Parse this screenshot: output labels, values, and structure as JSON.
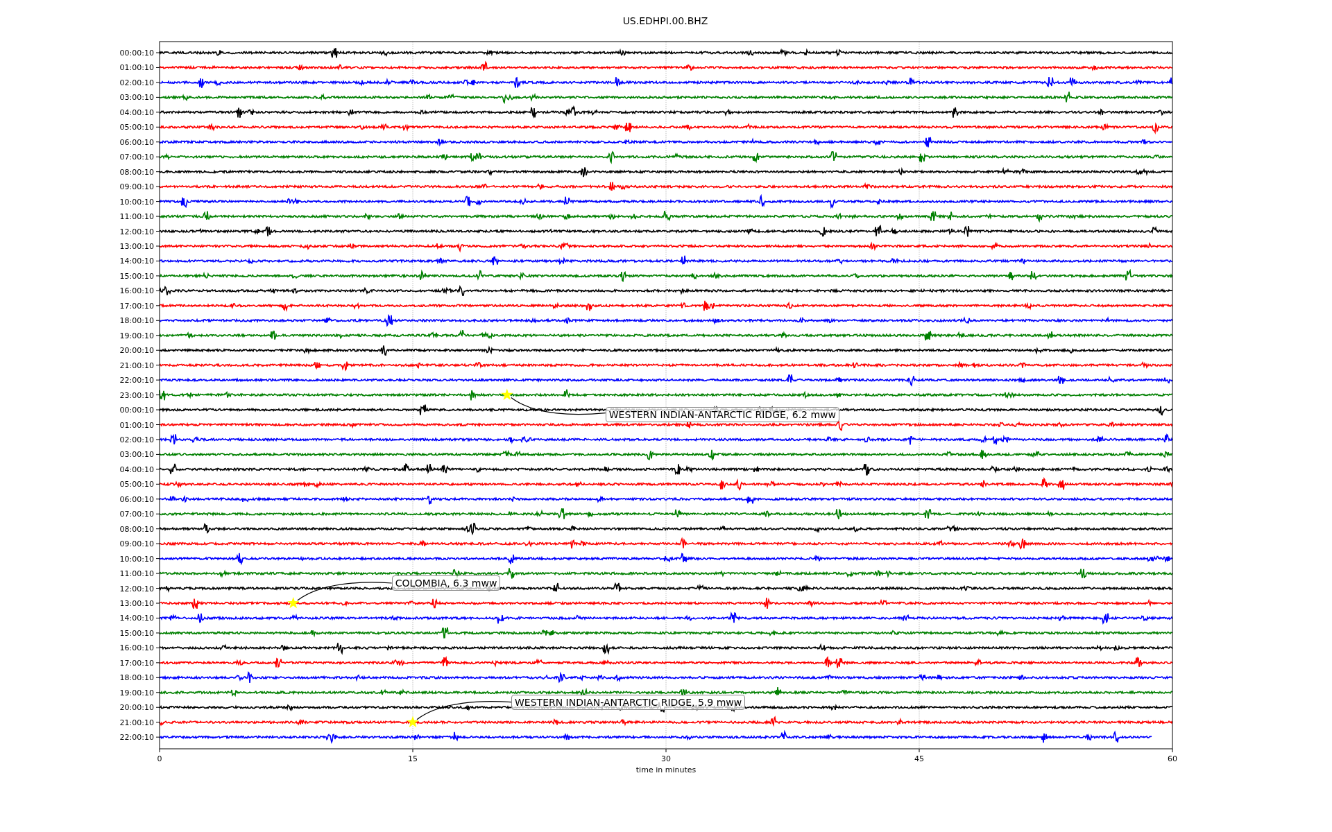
{
  "title": "US.EDHPI.00.BHZ",
  "traces": [
    {
      "time": "00:00:10",
      "color": "#000000",
      "level": 1
    },
    {
      "time": "01:00:10",
      "color": "#ff0000",
      "level": 1
    },
    {
      "time": "02:00:10",
      "color": "#0000ff",
      "level": 1
    },
    {
      "time": "03:00:10",
      "color": "#008000",
      "level": 1
    },
    {
      "time": "04:00:10",
      "color": "#000000",
      "level": 1
    },
    {
      "time": "05:00:10",
      "color": "#ff0000",
      "level": 1
    },
    {
      "time": "06:00:10",
      "color": "#0000ff",
      "level": 1
    },
    {
      "time": "07:00:10",
      "color": "#008000",
      "level": 1
    },
    {
      "time": "08:00:10",
      "color": "#000000",
      "level": 1
    },
    {
      "time": "09:00:10",
      "color": "#ff0000",
      "level": 1
    },
    {
      "time": "10:00:10",
      "color": "#0000ff",
      "level": 1
    },
    {
      "time": "11:00:10",
      "color": "#008000",
      "level": 1
    },
    {
      "time": "12:00:10",
      "color": "#000000",
      "level": 1
    },
    {
      "time": "13:00:10",
      "color": "#ff0000",
      "level": 1
    },
    {
      "time": "14:00:10",
      "color": "#0000ff",
      "level": 1
    },
    {
      "time": "15:00:10",
      "color": "#008000",
      "level": 1
    },
    {
      "time": "16:00:10",
      "color": "#000000",
      "level": 1
    },
    {
      "time": "17:00:10",
      "color": "#ff0000",
      "level": 1
    },
    {
      "time": "18:00:10",
      "color": "#0000ff",
      "level": 1
    },
    {
      "time": "19:00:10",
      "color": "#008000",
      "level": 1
    },
    {
      "time": "20:00:10",
      "color": "#000000",
      "level": 1
    },
    {
      "time": "21:00:10",
      "color": "#ff0000",
      "level": 1
    },
    {
      "time": "22:00:10",
      "color": "#0000ff",
      "level": 1
    },
    {
      "time": "23:00:10",
      "color": "#008000",
      "level": 1,
      "event": {
        "label": "WESTERN INDIAN-ANTARCTIC RIDGE, 6.2 mww",
        "level": 0.343,
        "label_below": true
      }
    },
    {
      "time": "00:00:10",
      "color": "#000000",
      "level": 1
    },
    {
      "time": "01:00:10",
      "color": "#ff0000",
      "level": 1
    },
    {
      "time": "02:00:10",
      "color": "#0000ff",
      "level": 1
    },
    {
      "time": "03:00:10",
      "color": "#008000",
      "level": 1
    },
    {
      "time": "04:00:10",
      "color": "#000000",
      "level": 1
    },
    {
      "time": "05:00:10",
      "color": "#ff0000",
      "level": 1
    },
    {
      "time": "06:00:10",
      "color": "#0000ff",
      "level": 1
    },
    {
      "time": "07:00:10",
      "color": "#008000",
      "level": 1
    },
    {
      "time": "08:00:10",
      "color": "#000000",
      "level": 1
    },
    {
      "time": "09:00:10",
      "color": "#ff0000",
      "level": 1
    },
    {
      "time": "10:00:10",
      "color": "#0000ff",
      "level": 1
    },
    {
      "time": "11:00:10",
      "color": "#008000",
      "level": 1
    },
    {
      "time": "12:00:10",
      "color": "#000000",
      "level": 1
    },
    {
      "time": "13:00:10",
      "color": "#ff0000",
      "level": 1,
      "event": {
        "label": "COLOMBIA, 6.3 mww",
        "level": 0.132,
        "label_below": false
      }
    },
    {
      "time": "14:00:10",
      "color": "#0000ff",
      "level": 1
    },
    {
      "time": "15:00:10",
      "color": "#008000",
      "level": 1
    },
    {
      "time": "16:00:10",
      "color": "#000000",
      "level": 1
    },
    {
      "time": "17:00:10",
      "color": "#ff0000",
      "level": 1
    },
    {
      "time": "18:00:10",
      "color": "#0000ff",
      "level": 1
    },
    {
      "time": "19:00:10",
      "color": "#008000",
      "level": 1
    },
    {
      "time": "20:00:10",
      "color": "#000000",
      "level": 1
    },
    {
      "time": "21:00:10",
      "color": "#ff0000",
      "level": 1,
      "event": {
        "label": "WESTERN INDIAN-ANTARCTIC RIDGE, 5.9 mww",
        "level": 0.25,
        "label_below": false
      }
    },
    {
      "time": "22:00:10",
      "color": "#0000ff",
      "level": 0.98
    }
  ],
  "xaxis": {
    "ticks": [
      "0",
      "15",
      "30",
      "45",
      "60"
    ],
    "label": "time in minutes"
  }
}
